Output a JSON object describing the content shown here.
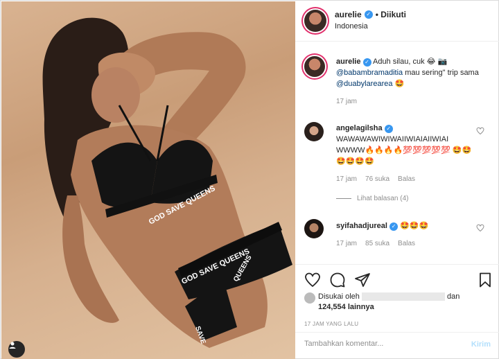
{
  "header": {
    "username": "aurelie",
    "follow_state": "• Diikuti",
    "location": "Indonesia"
  },
  "caption": {
    "username": "aurelie",
    "text_1": "Aduh silau, cuk 😂 📷",
    "mention_1": "@babambramaditia",
    "text_2": " mau sering\" trip sama ",
    "mention_2": "@duabylarearea",
    "text_3": " 🤩",
    "time": "17 jam"
  },
  "comments": [
    {
      "username": "angelagilsha",
      "text": "WAWAWAWIWIWAIIWIAIAIIWIAI WWWW🔥🔥🔥🔥💯💯💯💯💯 🤩🤩🤩🤩🤩🤩",
      "time": "17 jam",
      "likes": "76 suka",
      "reply": "Balas",
      "view_replies": "Lihat balasan (4)"
    },
    {
      "username": "syifahadjureal",
      "text": "🤩🤩🤩",
      "time": "17 jam",
      "likes": "85 suka",
      "reply": "Balas"
    }
  ],
  "likes": {
    "prefix": "Disukai oleh",
    "suffix": "dan",
    "count": "124,554 lainnya"
  },
  "timestamp": "17 JAM YANG LALU",
  "composer": {
    "placeholder": "Tambahkan komentar...",
    "post_label": "Kirim"
  },
  "swimsuit_print": {
    "top": "GOD SAVE QUEENS",
    "bottom_1": "GOD SAVE QUEENS",
    "bottom_2": "QUEENS",
    "bottom_3": "SAVE"
  },
  "colors": {
    "accent": "#3897f0",
    "mention": "#00376b",
    "muted": "#8e8e8e",
    "post_disabled": "#b2dffc"
  },
  "icons": [
    "heart-icon",
    "comment-icon",
    "share-icon",
    "bookmark-icon",
    "user-tag-icon",
    "verified-badge"
  ]
}
